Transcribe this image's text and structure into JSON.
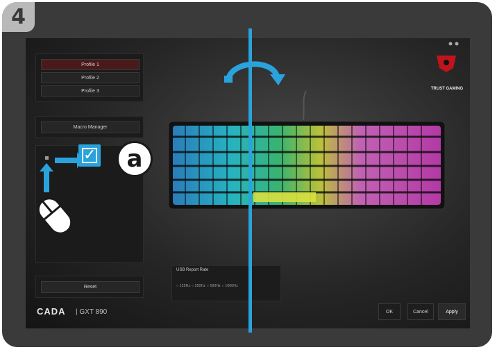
{
  "step_number": "4",
  "profiles": [
    "Profile 1",
    "Profile 2",
    "Profile 3"
  ],
  "macro_manager": "Macro Manager",
  "reset_label": "Reset",
  "app_title": "CADA",
  "app_model": "GXT 890",
  "usb_report_rate": {
    "label": "USB Report Rate",
    "options": "○ 125Hz  ○ 250Hz  ○ 500Hz  ○ 1000Hz"
  },
  "footer_buttons": {
    "ok": "OK",
    "cancel": "Cancel",
    "apply": "Apply"
  },
  "brand_logo_text": "TRUST GAMING",
  "badge_letter": "a",
  "checkbox_mark": "✓",
  "colors": {
    "accent": "#2aa3dc",
    "frame": "#3a3a3a",
    "step_tab": "#b9b9b9",
    "profile_selected": "#4a1a1a",
    "logo_red": "#c0141c"
  }
}
